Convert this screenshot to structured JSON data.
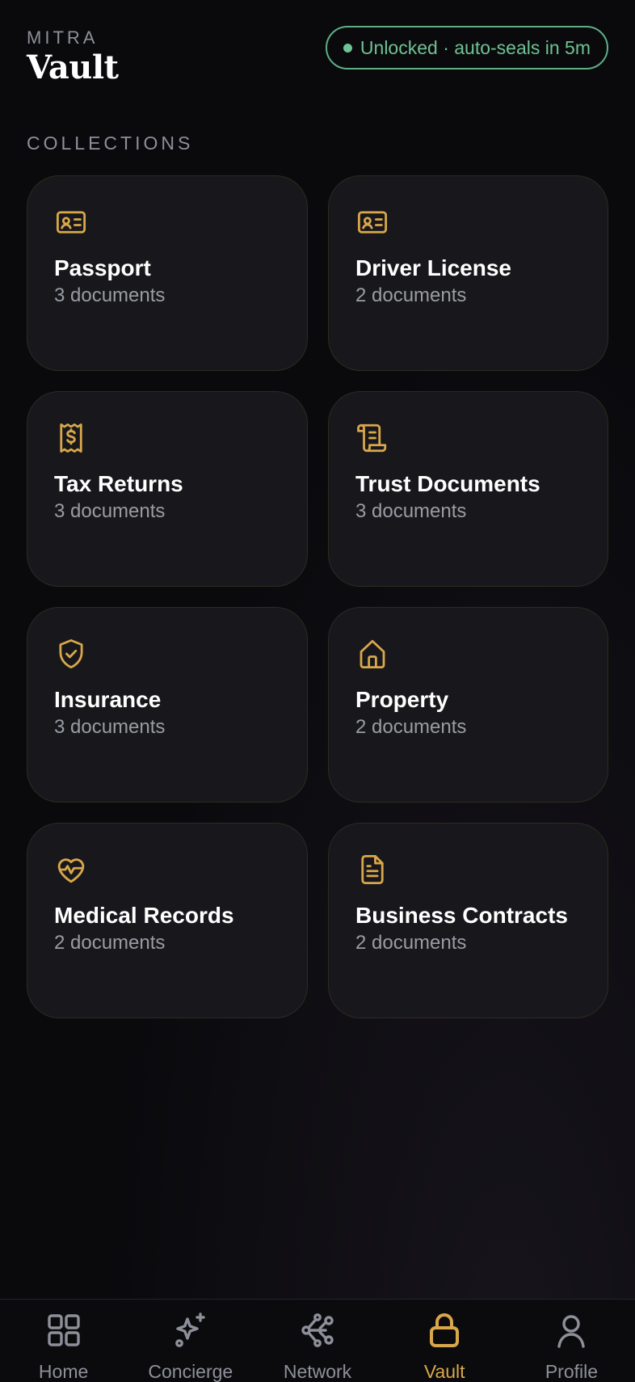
{
  "header": {
    "eyebrow": "MITRA",
    "title": "Vault",
    "status": "Unlocked · auto-seals in 5m"
  },
  "section_label": "COLLECTIONS",
  "collections": [
    {
      "title": "Passport",
      "count": "3 documents",
      "icon": "id-card-icon"
    },
    {
      "title": "Driver License",
      "count": "2 documents",
      "icon": "id-card-icon"
    },
    {
      "title": "Tax Returns",
      "count": "3 documents",
      "icon": "receipt-dollar-icon"
    },
    {
      "title": "Trust Documents",
      "count": "3 documents",
      "icon": "scroll-icon"
    },
    {
      "title": "Insurance",
      "count": "3 documents",
      "icon": "shield-check-icon"
    },
    {
      "title": "Property",
      "count": "2 documents",
      "icon": "house-icon"
    },
    {
      "title": "Medical Records",
      "count": "2 documents",
      "icon": "heart-pulse-icon"
    },
    {
      "title": "Business Contracts",
      "count": "2 documents",
      "icon": "document-icon"
    }
  ],
  "tabs": [
    {
      "label": "Home",
      "icon": "grid-icon",
      "active": false
    },
    {
      "label": "Concierge",
      "icon": "sparkle-icon",
      "active": false
    },
    {
      "label": "Network",
      "icon": "network-icon",
      "active": false
    },
    {
      "label": "Vault",
      "icon": "lock-icon",
      "active": true
    },
    {
      "label": "Profile",
      "icon": "person-icon",
      "active": false
    }
  ],
  "colors": {
    "accent": "#d9a74a",
    "status": "#6fc293",
    "background": "#0a0a0d",
    "card": "#18181c"
  }
}
